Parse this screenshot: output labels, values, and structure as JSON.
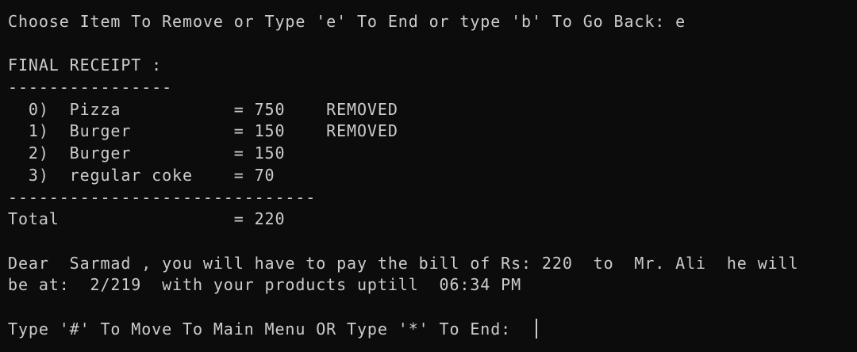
{
  "terminal": {
    "prompt_remove": "Choose Item To Remove or Type 'e' To End or type 'b' To Go Back: e",
    "receipt_title": "FINAL RECEIPT :",
    "divider_short": "----------------",
    "items": [
      "  0)  Pizza           = 750    REMOVED",
      "  1)  Burger          = 150    REMOVED",
      "  2)  Burger          = 150",
      "  3)  regular coke    = 70"
    ],
    "divider_long": "------------------------------",
    "total_line": "Total                 = 220",
    "bill_line_1": "Dear  Sarmad , you will have to pay the bill of Rs: 220  to  Mr. Ali  he will",
    "bill_line_2": "be at:  2/219  with your products uptill  06:34 PM",
    "prompt_menu": "Type '#' To Move To Main Menu OR Type '*' To End: "
  },
  "colors": {
    "background": "#0c0c0c",
    "text": "#cccccc"
  }
}
